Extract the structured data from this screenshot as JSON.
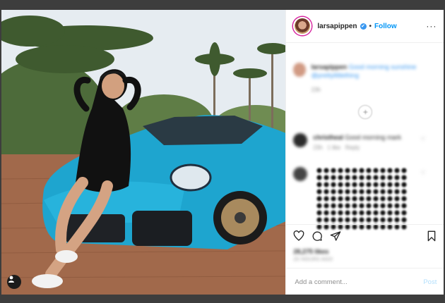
{
  "post": {
    "username": "larsapippen",
    "verified_glyph": "✔",
    "separator": "•",
    "follow_label": "Follow",
    "more_label": "···",
    "caption": {
      "username": "larsapippen",
      "text": "Good morning sunshine @prettylittlething",
      "time": "23h"
    },
    "comments": [
      {
        "username": "christheal",
        "text": "Good morning mark",
        "time": "23h",
        "likes": "1 like",
        "reply": "Reply"
      },
      {
        "username": "user",
        "text": "",
        "time": "",
        "likes": "",
        "reply": ""
      }
    ],
    "likes_text": "28,275 likes",
    "date_text": "20 HOURS AGO",
    "add_comment_placeholder": "Add a comment...",
    "post_label": "Post"
  },
  "icons": {
    "heart": "heart-icon",
    "comment": "comment-icon",
    "share": "share-icon",
    "bookmark": "bookmark-icon",
    "user_tag": "user-tag-icon",
    "more": "more-options-icon",
    "verified": "verified-icon"
  },
  "colors": {
    "accent": "#0095f6",
    "verified": "#3897f0",
    "text": "#262626",
    "muted": "#8e8e8e"
  }
}
